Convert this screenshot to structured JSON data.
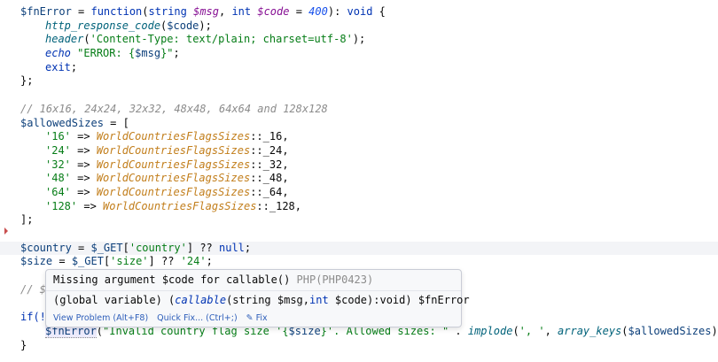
{
  "editor": {
    "lines": {
      "l1": {
        "a": "$fnError",
        "b": " = ",
        "c": "function",
        "d": "(",
        "e": "string ",
        "f": "$msg",
        "g": ", ",
        "h": "int ",
        "i": "$code",
        "j": " = ",
        "k": "400",
        "l": "): ",
        "m": "void",
        "n": " {"
      },
      "l2": {
        "a": "http_response_code",
        "b": "(",
        "c": "$code",
        "d": ");"
      },
      "l3": {
        "a": "header",
        "b": "(",
        "c": "'Content-Type: text/plain; charset=utf-8'",
        "d": ");"
      },
      "l4": {
        "a": "echo",
        "b": " ",
        "c": "\"ERROR: {",
        "d": "$msg",
        "e": "}\"",
        "f": ";"
      },
      "l5": {
        "a": "exit",
        "b": ";"
      },
      "l6": {
        "a": "};"
      },
      "l8": {
        "a": "// 16x16, 24x24, 32x32, 48x48, 64x64 and 128x128"
      },
      "l9": {
        "a": "$allowedSizes",
        "b": " = ["
      },
      "sizes": [
        {
          "key": "'16'",
          "cls": "WorldCountriesFlagsSizes",
          "c": "::_16,"
        },
        {
          "key": "'24'",
          "cls": "WorldCountriesFlagsSizes",
          "c": "::_24,"
        },
        {
          "key": "'32'",
          "cls": "WorldCountriesFlagsSizes",
          "c": "::_32,"
        },
        {
          "key": "'48'",
          "cls": "WorldCountriesFlagsSizes",
          "c": "::_48,"
        },
        {
          "key": "'64'",
          "cls": "WorldCountriesFlagsSizes",
          "c": "::_64,"
        },
        {
          "key": "'128'",
          "cls": "WorldCountriesFlagsSizes",
          "c": "::_128,"
        }
      ],
      "arrow": " => ",
      "l16": {
        "a": "];"
      },
      "l18": {
        "a": "$country",
        "b": " = ",
        "c": "$_GET",
        "d": "[",
        "e": "'country'",
        "f": "] ?? ",
        "g": "null",
        "h": ";"
      },
      "l19": {
        "a": "$size",
        "b": " = ",
        "c": "$_GET",
        "d": "[",
        "e": "'size'",
        "f": "] ?? ",
        "g": "'24'",
        "h": ";"
      },
      "l21": {
        "a": "// $"
      },
      "l23": {
        "a": "if(!"
      },
      "l24": {
        "a": "$fnError",
        "b": "(",
        "c": "\"Invalid country flag size '{",
        "d": "$size",
        "e": "}'. Allowed sizes: \"",
        "f": " . ",
        "g": "implode",
        "h": "(",
        "i": "', '",
        "j": ", ",
        "k": "array_keys",
        "l": "(",
        "m": "$allowedSizes",
        "n": ")));"
      },
      "l25": {
        "a": "}"
      }
    }
  },
  "popup": {
    "message": "Missing argument $code for callable()",
    "code": " PHP(PHP0423)",
    "sig": {
      "a": "(global variable) (",
      "b": "callable",
      "c": "(string $msg,",
      "d": "int",
      "e": " $code):void) $fnError"
    },
    "actions": {
      "view": "View Problem (Alt+F8)",
      "quick": "Quick Fix... (Ctrl+;)",
      "fix": "✎ Fix"
    }
  }
}
